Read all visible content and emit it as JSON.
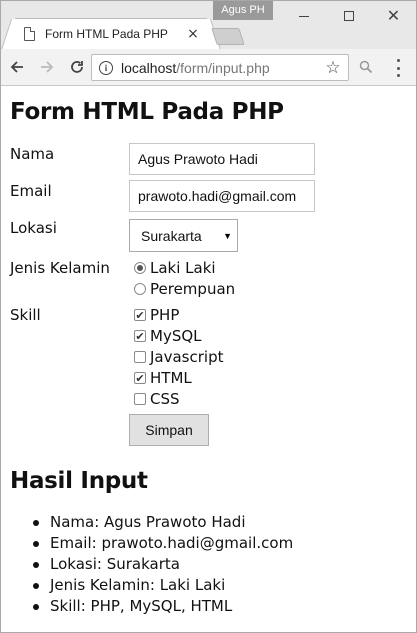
{
  "browser": {
    "profile_name": "Agus PH",
    "tab_title": "Form HTML Pada PHP",
    "tab_close": "×",
    "url_host": "localhost",
    "url_path": "/form/input.php",
    "star_icon": "☆",
    "menu_icon": "more-vert-icon"
  },
  "page": {
    "heading": "Form HTML Pada PHP",
    "form": {
      "nama_label": "Nama",
      "nama_value": "Agus Prawoto Hadi",
      "email_label": "Email",
      "email_value": "prawoto.hadi@gmail.com",
      "lokasi_label": "Lokasi",
      "lokasi_value": "Surakarta",
      "gender_label": "Jenis Kelamin",
      "gender_options": [
        {
          "label": "Laki Laki",
          "checked": true
        },
        {
          "label": "Perempuan",
          "checked": false
        }
      ],
      "skill_label": "Skill",
      "skill_options": [
        {
          "label": "PHP",
          "checked": true
        },
        {
          "label": "MySQL",
          "checked": true
        },
        {
          "label": "Javascript",
          "checked": false
        },
        {
          "label": "HTML",
          "checked": true
        },
        {
          "label": "CSS",
          "checked": false
        }
      ],
      "submit_label": "Simpan"
    },
    "result_heading": "Hasil Input",
    "results": [
      "Nama: Agus Prawoto Hadi",
      "Email: prawoto.hadi@gmail.com",
      "Lokasi: Surakarta",
      "Jenis Kelamin: Laki Laki",
      "Skill: PHP, MySQL, HTML"
    ]
  }
}
